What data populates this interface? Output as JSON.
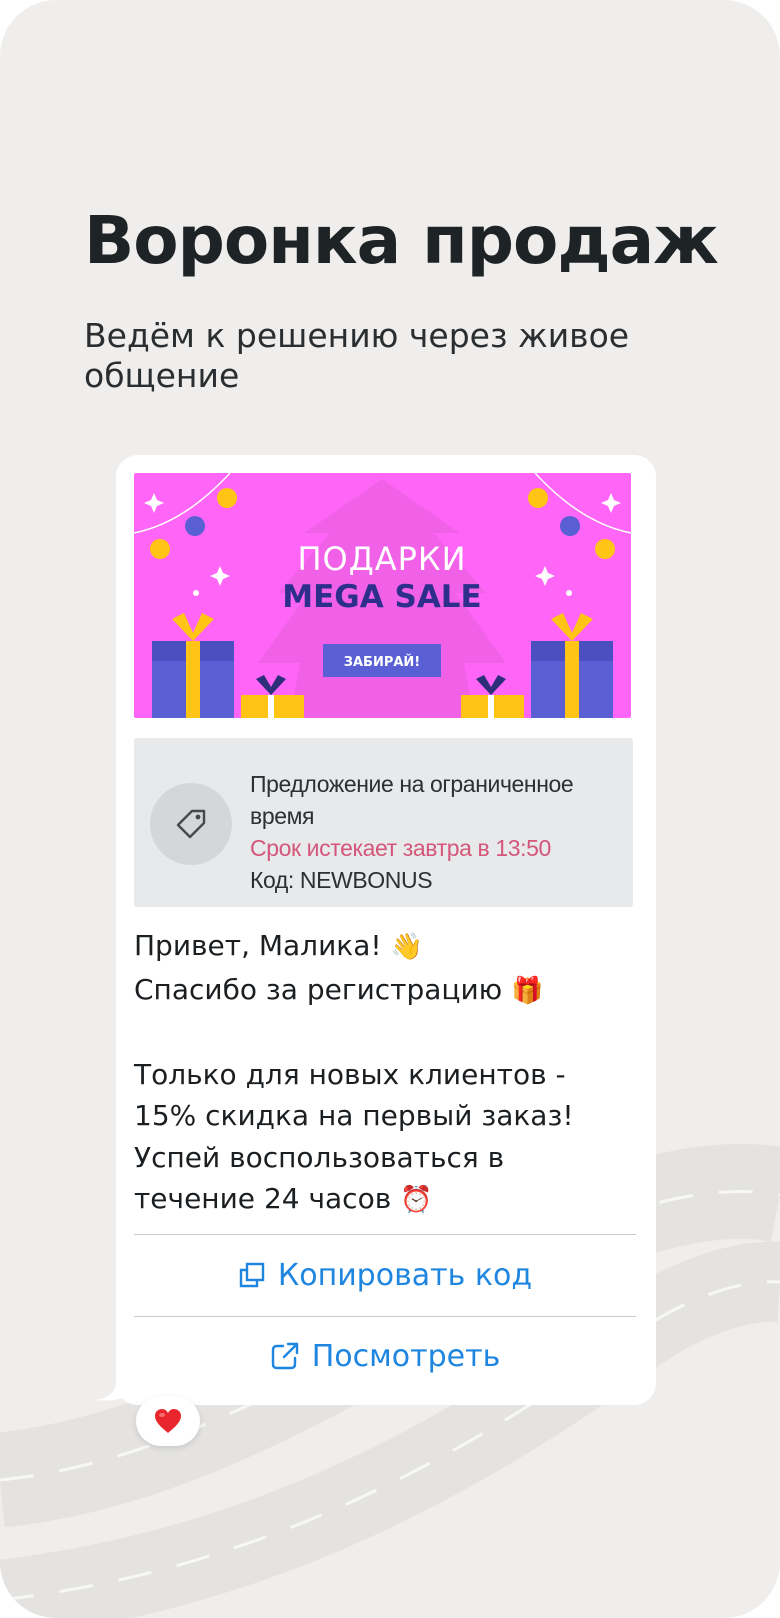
{
  "page": {
    "title": "Воронка продаж",
    "subtitle": "Ведём к решению через живое общение"
  },
  "banner": {
    "line1": "ПОДАРКИ",
    "line2": "MEGA SALE",
    "cta": "ЗАБИРАЙ!",
    "colors": {
      "background": "#ff66f7",
      "accent": "#5a5fd3",
      "gold": "#ffc414"
    }
  },
  "promo": {
    "icon": "price-tag-icon",
    "title": "Предложение на ограниченное время",
    "expires": "Срок истекает завтра в 13:50",
    "code": "Код: NEWBONUS"
  },
  "message": {
    "line1": "Привет, Малика!",
    "line1_emoji": "👋",
    "line2": "Спасибо за регистрацию",
    "line2_emoji": "🎁",
    "line3": "Только для новых клиентов -",
    "line4": "15% скидка на первый заказ!",
    "line5": "Успей воспользоваться в",
    "line6": "течение 24 часов",
    "line6_emoji": "⏰"
  },
  "actions": {
    "copy_code": {
      "label": "Копировать код",
      "icon": "copy-icon"
    },
    "view": {
      "label": "Посмотреть",
      "icon": "external-link-icon"
    }
  },
  "reaction": {
    "emoji": "❤️"
  },
  "colors": {
    "link": "#1f86e0",
    "expiry": "#d4567a",
    "background": "#efeeec"
  }
}
